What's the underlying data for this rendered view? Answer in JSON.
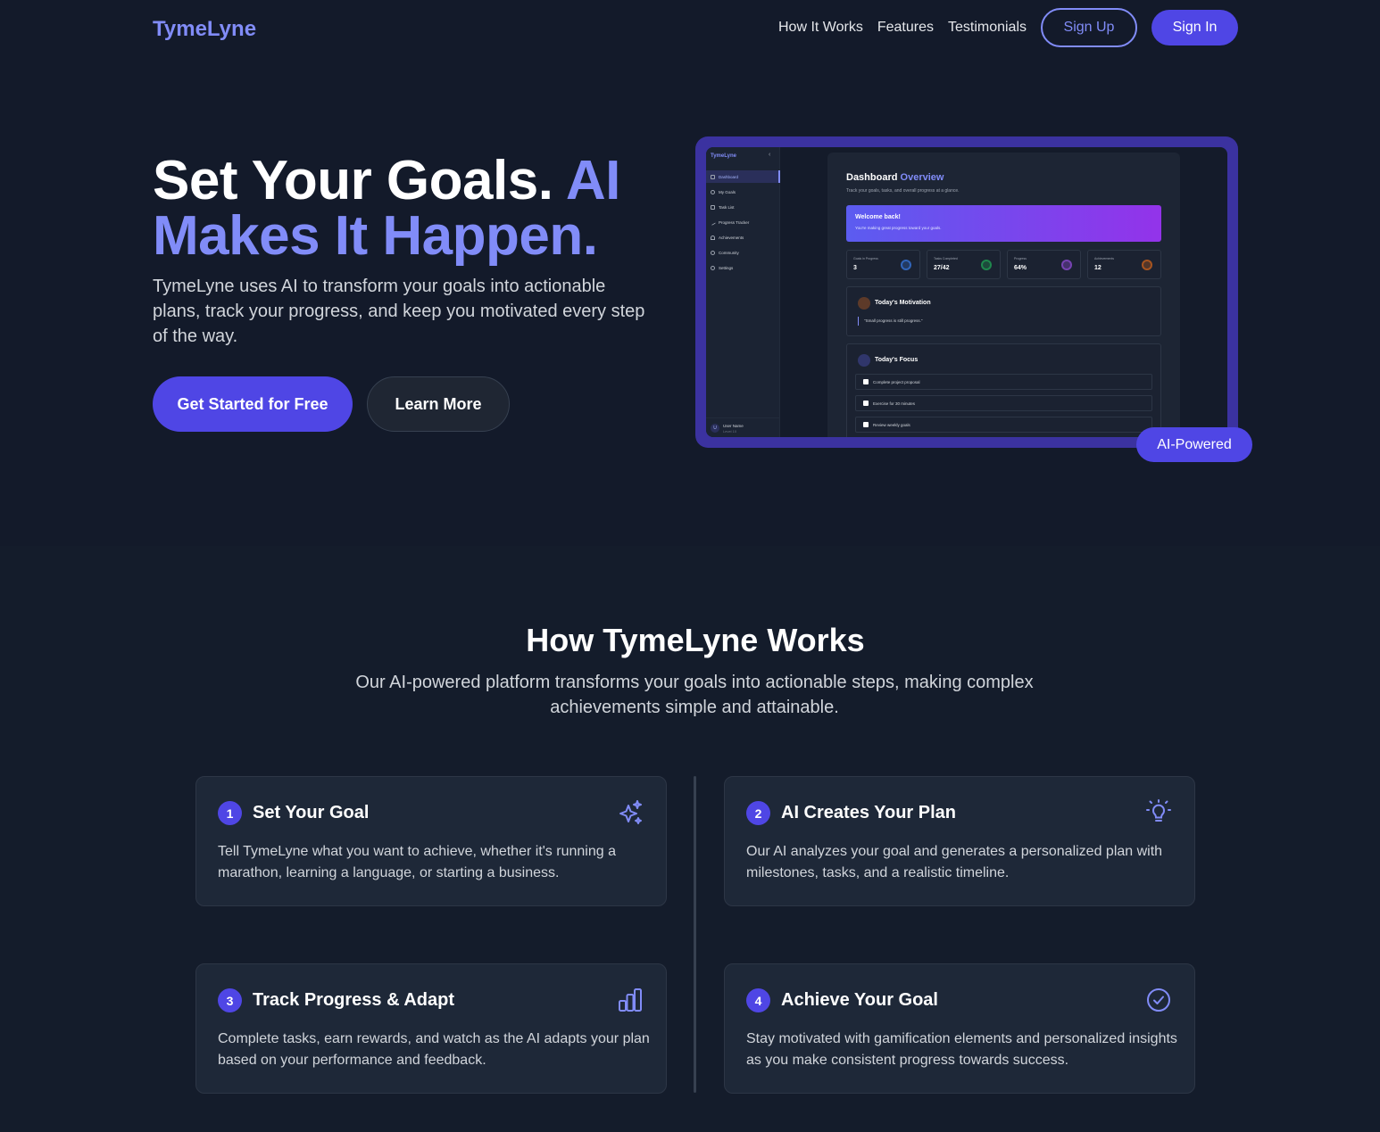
{
  "nav": {
    "logo": "TymeLyne",
    "links": [
      "How It Works",
      "Features",
      "Testimonials"
    ],
    "signup": "Sign Up",
    "signin": "Sign In"
  },
  "hero": {
    "title_white": "Set Your Goals.",
    "title_accent": "AI Makes It Happen.",
    "description": "TymeLyne uses AI to transform your goals into actionable plans, track your progress, and keep you motivated every step of the way.",
    "cta_primary": "Get Started for Free",
    "cta_secondary": "Learn More",
    "badge": "AI-Powered"
  },
  "mockup": {
    "logo": "TymeLyne",
    "nav_items": [
      "Dashboard",
      "My Goals",
      "Task List",
      "Progress Tracker",
      "Achievements",
      "Community",
      "Settings"
    ],
    "user_name": "User Name",
    "user_level": "Level 10",
    "user_initial": "U",
    "title_white": "Dashboard",
    "title_accent": "Overview",
    "subtitle": "Track your goals, tasks, and overall progress at a glance.",
    "welcome_title": "Welcome back!",
    "welcome_sub": "You're making great progress toward your goals.",
    "stats": [
      {
        "label": "Goals in Progress",
        "value": "3",
        "color": "#3b82f6"
      },
      {
        "label": "Tasks Completed",
        "value": "27/42",
        "color": "#22c55e"
      },
      {
        "label": "Progress",
        "value": "64%",
        "color": "#a855f7"
      },
      {
        "label": "Achievements",
        "value": "12",
        "color": "#f97316"
      }
    ],
    "motivation_title": "Today's Motivation",
    "motivation_quote": "\"Small progress is still progress.\"",
    "focus_title": "Today's Focus",
    "focus_tasks": [
      "Complete project proposal",
      "Exercise for 30 minutes",
      "Review weekly goals"
    ]
  },
  "how": {
    "title": "How TymeLyne Works",
    "description": "Our AI-powered platform transforms your goals into actionable steps, making complex achievements simple and attainable.",
    "steps": [
      {
        "num": "1",
        "title": "Set Your Goal",
        "desc": "Tell TymeLyne what you want to achieve, whether it's running a marathon, learning a language, or starting a business.",
        "icon": "sparkles-icon"
      },
      {
        "num": "2",
        "title": "AI Creates Your Plan",
        "desc": "Our AI analyzes your goal and generates a personalized plan with milestones, tasks, and a realistic timeline.",
        "icon": "lightbulb-icon"
      },
      {
        "num": "3",
        "title": "Track Progress & Adapt",
        "desc": "Complete tasks, earn rewards, and watch as the AI adapts your plan based on your performance and feedback.",
        "icon": "bar-chart-icon"
      },
      {
        "num": "4",
        "title": "Achieve Your Goal",
        "desc": "Stay motivated with gamification elements and personalized insights as you make consistent progress towards success.",
        "icon": "check-circle-icon"
      }
    ]
  },
  "colors": {
    "background": "#131a2a",
    "accent": "#818cf8",
    "primary": "#4f46e5"
  }
}
